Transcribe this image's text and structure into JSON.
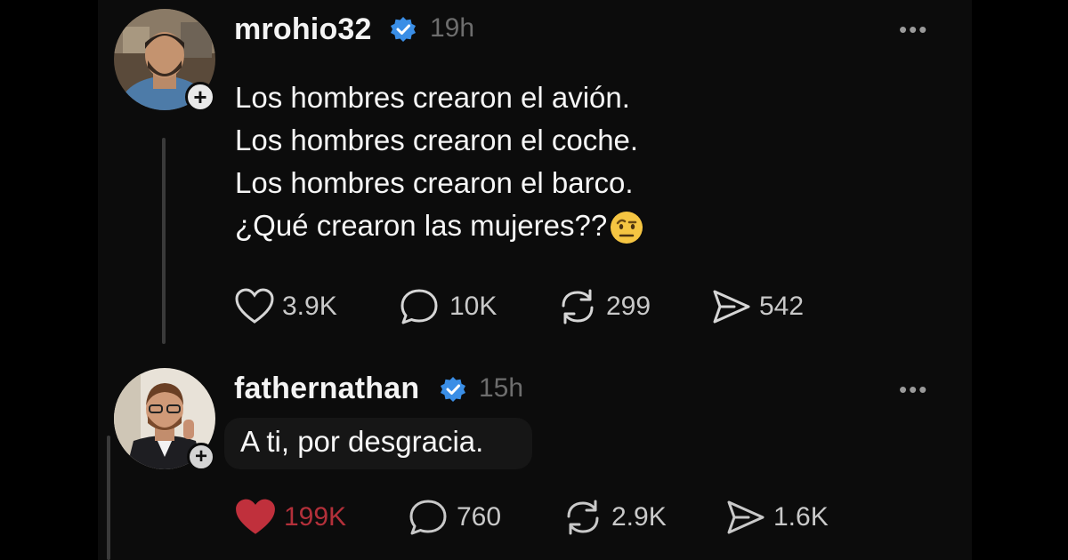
{
  "posts": [
    {
      "username": "mrohio32",
      "time": "19h",
      "more_label": "•••",
      "lines": [
        "Los hombres crearon el avión.",
        "Los hombres crearon el coche.",
        "Los hombres crearon el barco.",
        "¿Qué crearon las mujeres??"
      ],
      "emoji": "raised-eyebrow-face",
      "actions": {
        "likes": "3.9K",
        "replies": "10K",
        "reposts": "299",
        "shares": "542"
      }
    },
    {
      "username": "fathernathan",
      "time": "15h",
      "more_label": "•••",
      "text": "A ti, por desgracia.",
      "liked": true,
      "actions": {
        "likes": "199K",
        "replies": "760",
        "reposts": "2.9K",
        "shares": "1.6K"
      }
    }
  ],
  "colors": {
    "background": "#000000",
    "panel": "#0c0c0c",
    "verified": "#3a8ee6",
    "liked_heart": "#c0303c",
    "muted": "#6d6d6d"
  },
  "icons": [
    "plus-icon",
    "verified-badge-icon",
    "heart-icon",
    "comment-icon",
    "repost-icon",
    "share-icon",
    "more-icon"
  ]
}
